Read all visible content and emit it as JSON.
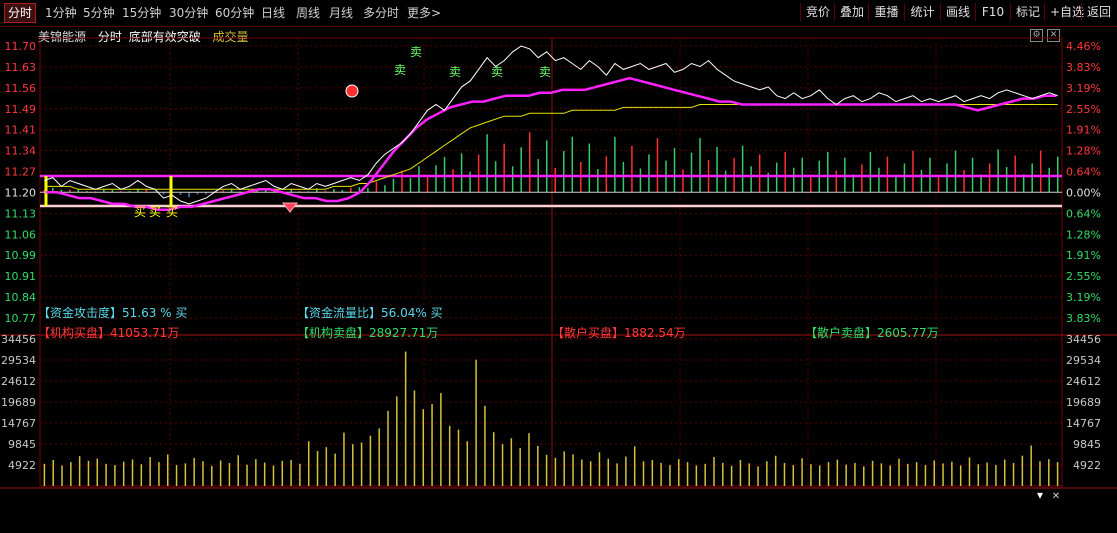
{
  "tabs": [
    "分时",
    "1分钟",
    "5分钟",
    "15分钟",
    "30分钟",
    "60分钟",
    "日线",
    "周线",
    "月线",
    "多分时",
    "更多>"
  ],
  "active_tab": "分时",
  "right_tabs": [
    "竞价",
    "叠加",
    "重播",
    "统计",
    "画线",
    "F10",
    "标记",
    "+自选",
    "返回"
  ],
  "header": {
    "stock_name": "美锦能源",
    "mode": "分时",
    "strategy": "底部有效突破",
    "volume_label": "成交量"
  },
  "price_axis": {
    "left": [
      "11.70",
      "11.63",
      "11.56",
      "11.49",
      "11.41",
      "11.34",
      "11.27",
      "11.20",
      "11.13",
      "11.06",
      "10.99",
      "10.91",
      "10.84",
      "10.77"
    ],
    "right": [
      "4.46%",
      "3.83%",
      "3.19%",
      "2.55%",
      "1.91%",
      "1.28%",
      "0.64%",
      "0.00%",
      "0.64%",
      "1.28%",
      "1.91%",
      "2.55%",
      "3.19%",
      "3.83%"
    ]
  },
  "volume_axis": [
    "34456",
    "29534",
    "24612",
    "19689",
    "14767",
    "9845",
    "4922"
  ],
  "signals": {
    "buy": "买",
    "sell": "卖"
  },
  "metrics": {
    "attack_label": "【资金攻击度】",
    "attack_value": "51.63 % 买",
    "flow_label": "【资金流量比】",
    "flow_value": "56.04% 买",
    "inst_buy_label": "【机构买盘】",
    "inst_buy_value": "41053.71万",
    "inst_sell_label": "【机构卖盘】",
    "inst_sell_value": "28927.71万",
    "retail_buy_label": "【散户买盘】",
    "retail_buy_value": "1882.54万",
    "retail_sell_label": "【散户卖盘】",
    "retail_sell_value": "2605.77万"
  },
  "colors": {
    "price_line": "#ffffff",
    "avg_line": "#e6e600",
    "signal_line": "#ff22ff",
    "up": "#ff3030",
    "down": "#00cc66",
    "volume": "#d4c23a",
    "accent_cyan": "#5ad8e8"
  },
  "chart_data": {
    "type": "line",
    "y_range": [
      10.77,
      11.7
    ],
    "y_pct_range": [
      -3.83,
      4.46
    ],
    "prev_close": 11.2,
    "price": [
      11.24,
      11.25,
      11.22,
      11.24,
      11.23,
      11.22,
      11.21,
      11.22,
      11.23,
      11.21,
      11.22,
      11.24,
      11.22,
      11.21,
      11.18,
      11.19,
      11.17,
      11.16,
      11.17,
      11.18,
      11.2,
      11.22,
      11.23,
      11.21,
      11.22,
      11.23,
      11.24,
      11.22,
      11.21,
      11.23,
      11.22,
      11.21,
      11.23,
      11.22,
      11.23,
      11.24,
      11.25,
      11.24,
      11.26,
      11.3,
      11.33,
      11.35,
      11.37,
      11.4,
      11.44,
      11.48,
      11.5,
      11.48,
      11.52,
      11.56,
      11.58,
      11.62,
      11.66,
      11.63,
      11.65,
      11.68,
      11.7,
      11.69,
      11.66,
      11.68,
      11.65,
      11.66,
      11.64,
      11.62,
      11.65,
      11.63,
      11.6,
      11.64,
      11.62,
      11.63,
      11.64,
      11.62,
      11.63,
      11.64,
      11.61,
      11.62,
      11.64,
      11.63,
      11.65,
      11.62,
      11.6,
      11.58,
      11.57,
      11.56,
      11.55,
      11.56,
      11.53,
      11.52,
      11.54,
      11.52,
      11.53,
      11.55,
      11.52,
      11.5,
      11.52,
      11.53,
      11.51,
      11.52,
      11.54,
      11.53,
      11.51,
      11.52,
      11.53,
      11.51,
      11.52,
      11.51,
      11.52,
      11.53,
      11.51,
      11.52,
      11.53,
      11.52,
      11.54,
      11.55,
      11.54,
      11.53,
      11.52,
      11.53,
      11.54,
      11.53
    ],
    "avg": [
      11.22,
      11.22,
      11.22,
      11.22,
      11.21,
      11.21,
      11.21,
      11.21,
      11.21,
      11.21,
      11.21,
      11.21,
      11.21,
      11.21,
      11.21,
      11.21,
      11.21,
      11.21,
      11.21,
      11.21,
      11.21,
      11.21,
      11.21,
      11.21,
      11.21,
      11.21,
      11.21,
      11.21,
      11.21,
      11.21,
      11.21,
      11.21,
      11.21,
      11.21,
      11.22,
      11.22,
      11.22,
      11.23,
      11.23,
      11.24,
      11.25,
      11.26,
      11.27,
      11.28,
      11.3,
      11.32,
      11.34,
      11.36,
      11.38,
      11.4,
      11.42,
      11.43,
      11.44,
      11.45,
      11.46,
      11.46,
      11.46,
      11.47,
      11.47,
      11.47,
      11.47,
      11.47,
      11.48,
      11.48,
      11.48,
      11.48,
      11.48,
      11.48,
      11.49,
      11.49,
      11.49,
      11.49,
      11.49,
      11.49,
      11.49,
      11.49,
      11.49,
      11.5,
      11.5,
      11.5,
      11.5,
      11.5,
      11.5,
      11.5,
      11.5,
      11.5,
      11.5,
      11.5,
      11.5,
      11.5,
      11.5,
      11.5,
      11.5,
      11.5,
      11.5,
      11.5,
      11.5,
      11.5,
      11.5,
      11.5,
      11.5,
      11.5,
      11.5,
      11.5,
      11.5,
      11.5,
      11.5,
      11.5,
      11.5,
      11.5,
      11.5,
      11.5,
      11.5,
      11.5,
      11.5,
      11.5,
      11.5,
      11.5,
      11.5,
      11.5
    ],
    "signal_line": [
      11.2,
      11.2,
      11.19,
      11.18,
      11.18,
      11.17,
      11.16,
      11.16,
      11.15,
      11.15,
      11.14,
      11.14,
      11.15,
      11.15,
      11.16,
      11.17,
      11.18,
      11.19,
      11.2,
      11.21,
      11.21,
      11.2,
      11.19,
      11.18,
      11.18,
      11.17,
      11.17,
      11.18,
      11.2,
      11.24,
      11.29,
      11.34,
      11.38,
      11.42,
      11.45,
      11.47,
      11.49,
      11.5,
      11.51,
      11.51,
      11.52,
      11.53,
      11.53,
      11.53,
      11.54,
      11.54,
      11.55,
      11.55,
      11.55,
      11.56,
      11.57,
      11.58,
      11.59,
      11.58,
      11.57,
      11.56,
      11.55,
      11.54,
      11.53,
      11.52,
      11.51,
      11.51,
      11.5,
      11.5,
      11.5,
      11.5,
      11.5,
      11.5,
      11.5,
      11.5,
      11.5,
      11.5,
      11.5,
      11.5,
      11.5,
      11.5,
      11.5,
      11.5,
      11.5,
      11.5,
      11.5,
      11.5,
      11.49,
      11.48,
      11.49,
      11.5,
      11.51,
      11.52,
      11.52,
      11.53,
      11.53
    ],
    "volume": [
      5200,
      6100,
      4800,
      5600,
      7000,
      5900,
      6400,
      5200,
      4900,
      5700,
      6200,
      5100,
      6800,
      5600,
      7400,
      4900,
      5300,
      6600,
      5800,
      4700,
      6000,
      5400,
      7200,
      5000,
      6300,
      5500,
      4800,
      5900,
      6100,
      5200,
      10500,
      8200,
      9100,
      7600,
      12500,
      9800,
      10200,
      11800,
      13500,
      17600,
      21000,
      31500,
      22400,
      18000,
      19200,
      21800,
      14100,
      13200,
      10500,
      29600,
      18800,
      12600,
      9800,
      11200,
      8900,
      12400,
      9400,
      7300,
      6600,
      8100,
      7400,
      6200,
      5800,
      7900,
      6400,
      5300,
      6900,
      9300,
      5800,
      6100,
      5400,
      4900,
      6300,
      5600,
      4800,
      5200,
      6800,
      5400,
      4700,
      6100,
      5300,
      4600,
      5800,
      7100,
      5400,
      4900,
      6500,
      5100,
      4800,
      5600,
      6200,
      5000,
      5400,
      4600,
      5900,
      5300,
      4800,
      6400,
      5200,
      5600,
      4900,
      6000,
      5300,
      5700,
      4800,
      6700,
      5100,
      5500,
      4900,
      6200,
      5400,
      7100,
      9500,
      5800,
      6300,
      5600
    ]
  }
}
